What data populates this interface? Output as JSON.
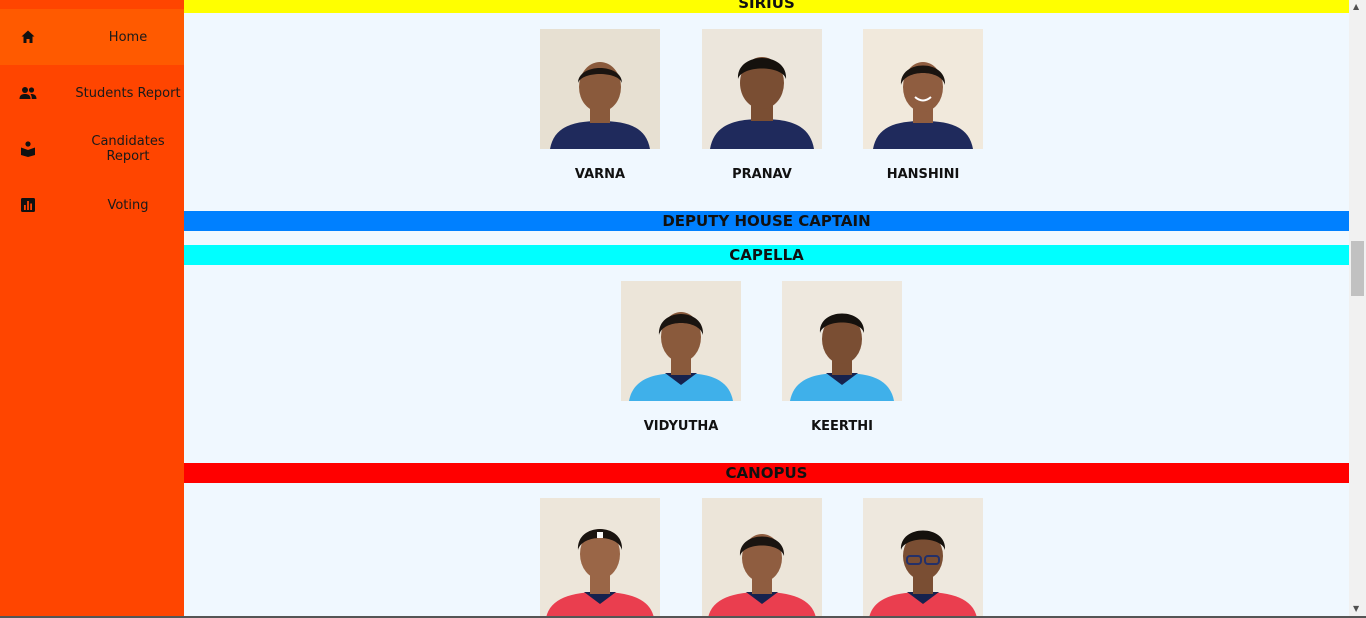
{
  "sidebar": {
    "items": [
      {
        "label": "Home",
        "icon": "home-icon"
      },
      {
        "label": "Students Report",
        "icon": "users-icon"
      },
      {
        "label": "Candidates Report",
        "icon": "book-reader-icon"
      },
      {
        "label": "Voting",
        "icon": "bar-chart-icon"
      }
    ]
  },
  "sections": {
    "sirius": {
      "title": "SIRIUS",
      "color": "#ffff00",
      "candidates": [
        "VARNA",
        "PRANAV",
        "HANSHINI"
      ]
    },
    "deputy": {
      "title": "DEPUTY HOUSE CAPTAIN",
      "color": "#0080ff"
    },
    "capella": {
      "title": "CAPELLA",
      "color": "#00ffff",
      "candidates": [
        "VIDYUTHA",
        "KEERTHI"
      ]
    },
    "canopus": {
      "title": "CANOPUS",
      "color": "#ff0000"
    }
  },
  "colors": {
    "sidebar": "#ff4500",
    "active": "#ff5a00",
    "content_bg": "#f0f8ff"
  }
}
